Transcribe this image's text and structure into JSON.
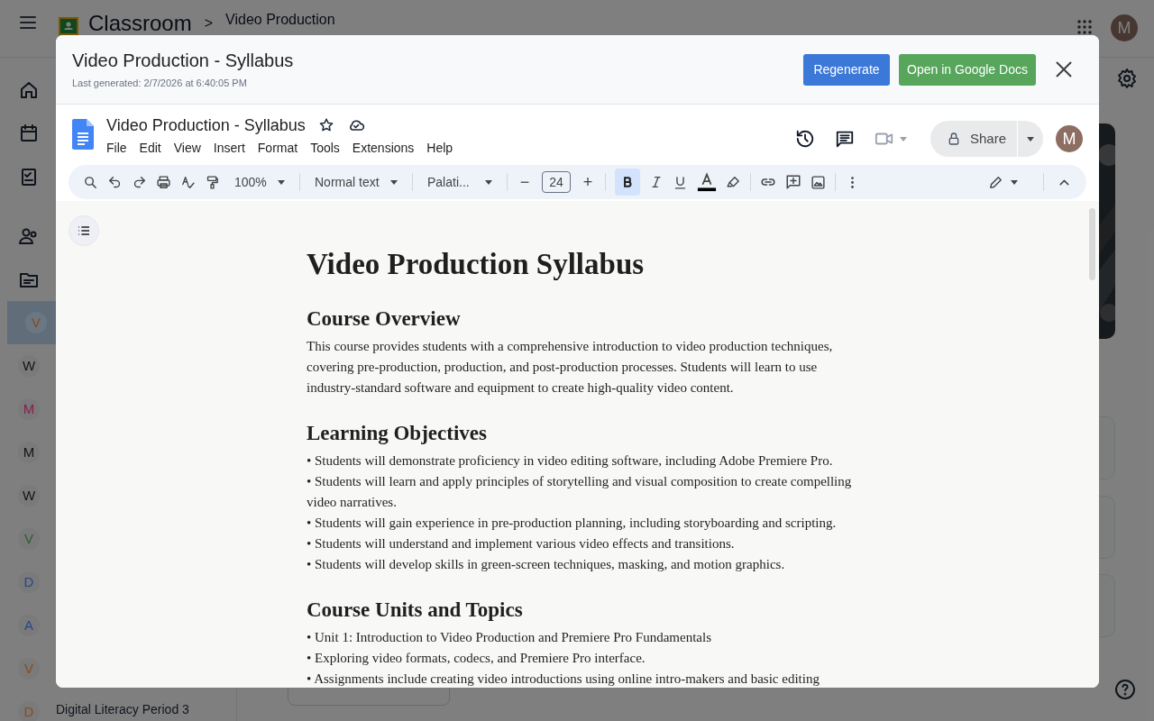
{
  "classroom": {
    "app_name": "Classroom",
    "breadcrumb_separator": ">",
    "course_title": "Video Production",
    "classes": [
      {
        "initial": "V",
        "color": "#8a4a1c",
        "selected": true
      },
      {
        "initial": "W",
        "color": "#141414",
        "selected": false
      },
      {
        "initial": "M",
        "color": "#8a1c4e",
        "selected": false
      },
      {
        "initial": "M",
        "color": "#141414",
        "selected": false
      },
      {
        "initial": "W",
        "color": "#141414",
        "selected": false
      },
      {
        "initial": "V",
        "color": "#2c5e36",
        "selected": false
      },
      {
        "initial": "D",
        "color": "#27468a",
        "selected": false
      },
      {
        "initial": "A",
        "color": "#27468a",
        "selected": false
      },
      {
        "initial": "V",
        "color": "#8a4a1c",
        "selected": false
      },
      {
        "initial": "D",
        "color": "#8a4a1c",
        "selected": false,
        "title": "Digital Literacy Period 3"
      }
    ],
    "avatar": "M"
  },
  "modal": {
    "title": "Video Production - Syllabus",
    "last_generated": "Last generated: 2/7/2026 at 6:40:05 PM",
    "buttons": [
      {
        "label": "Regenerate",
        "kind": "primary"
      },
      {
        "label": "Open in Google Docs",
        "kind": "success"
      }
    ],
    "docs": {
      "doc_title": "Video Production - Syllabus",
      "menus": [
        "File",
        "Edit",
        "View",
        "Insert",
        "Format",
        "Tools",
        "Extensions",
        "Help"
      ],
      "share_label": "Share",
      "avatar": "M",
      "toolbar": {
        "zoom": "100%",
        "style": "Normal text",
        "font": "Palati...",
        "font_size": "24",
        "minus": "−",
        "plus": "+",
        "bold_active": true
      },
      "content": [
        {
          "kind": "title",
          "text": "Video Production Syllabus"
        },
        {
          "kind": "heading",
          "text": "Course Overview"
        },
        {
          "kind": "paragraph",
          "text": "This course provides students with a comprehensive introduction to video production techniques, covering pre-production, production, and post-production processes. Students will learn to use industry-standard software and equipment to create high-quality video content."
        },
        {
          "kind": "heading",
          "text": "Learning Objectives"
        },
        {
          "kind": "bullet",
          "text": "• Students will demonstrate proficiency in video editing software, including Adobe Premiere Pro."
        },
        {
          "kind": "bullet",
          "text": "• Students will learn and apply principles of storytelling and visual composition to create compelling video narratives."
        },
        {
          "kind": "bullet",
          "text": "• Students will gain experience in pre-production planning, including storyboarding and scripting."
        },
        {
          "kind": "bullet",
          "text": "• Students will understand and implement various video effects and transitions."
        },
        {
          "kind": "bullet",
          "text": "• Students will develop skills in green-screen techniques, masking, and motion graphics."
        },
        {
          "kind": "heading",
          "text": "Course Units and Topics"
        },
        {
          "kind": "bullet",
          "text": "• Unit 1: Introduction to Video Production and Premiere Pro Fundamentals"
        },
        {
          "kind": "bullet",
          "text": "• Exploring video formats, codecs, and Premiere Pro interface."
        },
        {
          "kind": "bullet",
          "text": "• Assignments include creating video introductions using online intro-makers and basic editing"
        }
      ]
    }
  }
}
